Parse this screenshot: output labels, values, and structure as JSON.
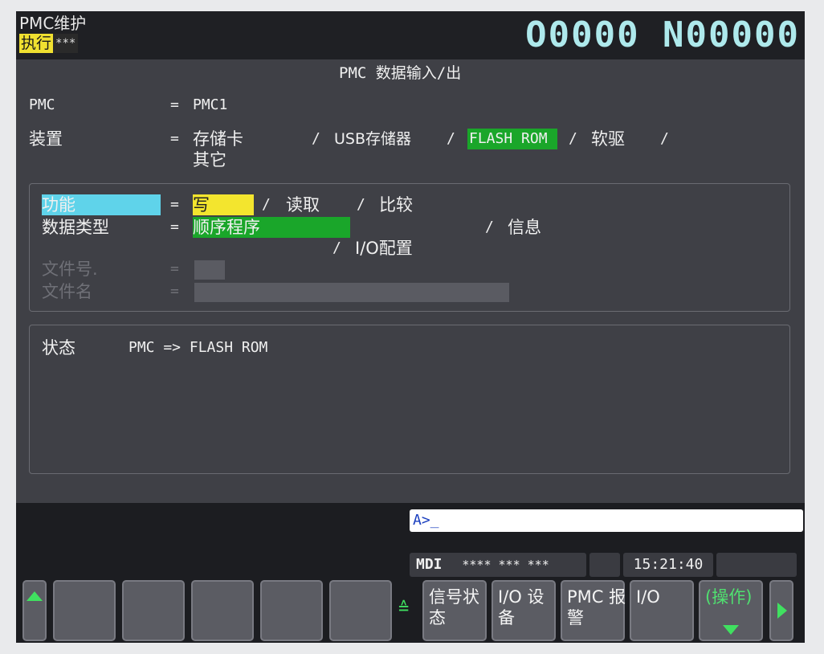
{
  "header": {
    "mode": "PMC维护",
    "state": "执行",
    "state_stars": "***",
    "program": "O0000 N00000"
  },
  "title": "PMC 数据输入/出",
  "pmc": {
    "label": "PMC",
    "eq": "=",
    "value": "PMC1"
  },
  "device": {
    "label": "装置",
    "eq": "=",
    "options": [
      "存储卡",
      "USB存储器",
      "FLASH ROM",
      "软驱",
      "其它"
    ],
    "sep": "/",
    "selected": "FLASH ROM"
  },
  "function": {
    "label": "功能",
    "eq": "=",
    "options": [
      "写",
      "读取",
      "比较"
    ],
    "sep": "/",
    "selected": "写"
  },
  "data_type": {
    "label": "数据类型",
    "eq": "=",
    "options": [
      "顺序程序",
      "信息",
      "I/O配置"
    ],
    "sep": "/",
    "selected": "顺序程序"
  },
  "file_no": {
    "label": "文件号.",
    "eq": "="
  },
  "file_name": {
    "label": "文件名",
    "eq": "="
  },
  "status": {
    "label": "状态",
    "value": "PMC => FLASH ROM"
  },
  "command_line": "A>_",
  "status_bar": {
    "mode": "MDI",
    "stars": "**** *** ***",
    "time": "15:21:40"
  },
  "softkeys": [
    {
      "label": ""
    },
    {
      "label": ""
    },
    {
      "label": ""
    },
    {
      "label": ""
    },
    {
      "label": ""
    },
    {
      "label": "信号状\n态"
    },
    {
      "label": "I/O 设\n备"
    },
    {
      "label": "PMC 报\n警"
    },
    {
      "label": "I/O"
    },
    {
      "label": "(操作)"
    }
  ],
  "colors": {
    "cyan": "#5fd3ea",
    "yellow": "#f3e52e",
    "green": "#1aa62a",
    "screen": "#3f4046"
  }
}
